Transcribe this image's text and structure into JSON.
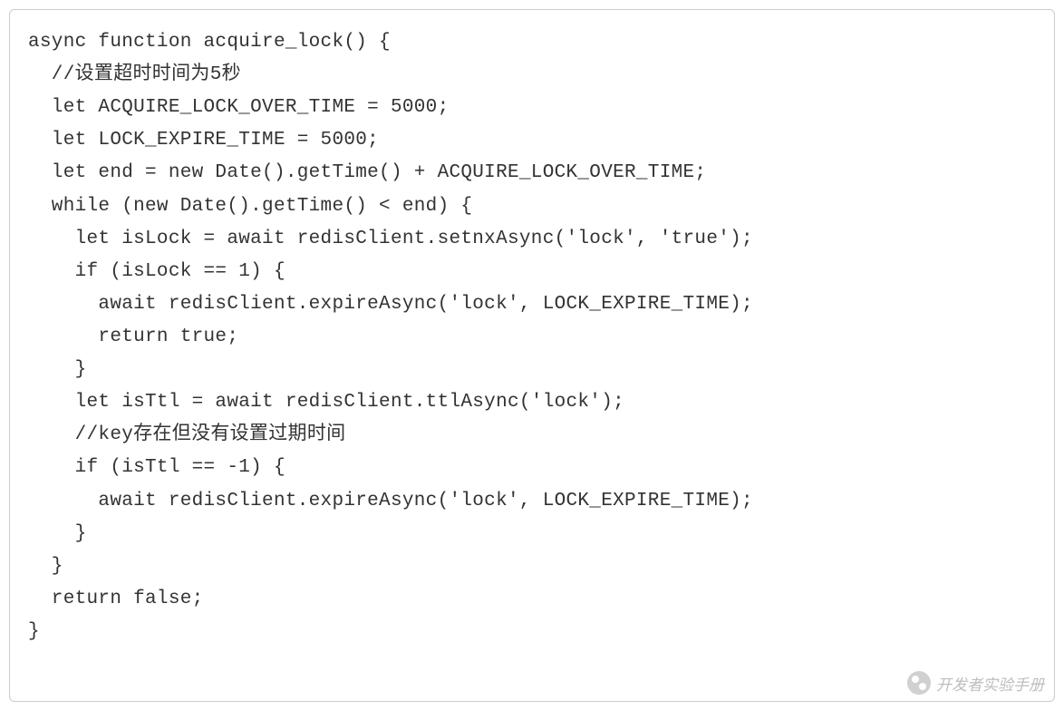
{
  "code": {
    "lines": [
      "async function acquire_lock() {",
      "  //设置超时时间为5秒",
      "  let ACQUIRE_LOCK_OVER_TIME = 5000;",
      "  let LOCK_EXPIRE_TIME = 5000;",
      "  let end = new Date().getTime() + ACQUIRE_LOCK_OVER_TIME;",
      "  while (new Date().getTime() < end) {",
      "    let isLock = await redisClient.setnxAsync('lock', 'true');",
      "    if (isLock == 1) {",
      "      await redisClient.expireAsync('lock', LOCK_EXPIRE_TIME);",
      "      return true;",
      "    }",
      "    let isTtl = await redisClient.ttlAsync('lock');",
      "    //key存在但没有设置过期时间",
      "    if (isTtl == -1) {",
      "      await redisClient.expireAsync('lock', LOCK_EXPIRE_TIME);",
      "    }",
      "  }",
      "  return false;",
      "}"
    ]
  },
  "watermark": {
    "text": "开发者实验手册"
  }
}
